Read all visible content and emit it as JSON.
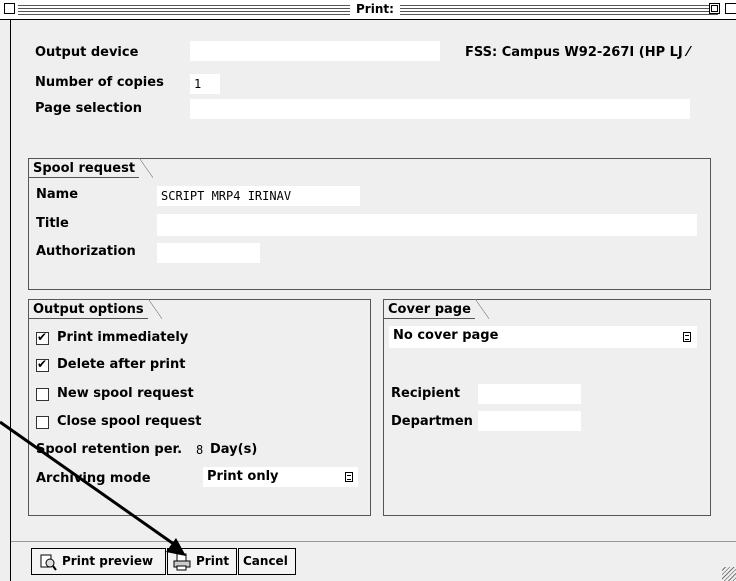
{
  "window": {
    "title": "Print:"
  },
  "header": {
    "output_device_label": "Output device",
    "output_device_value": "",
    "device_info": "FSS: Campus W92-267I (HP LJ ⁄",
    "copies_label": "Number of copies",
    "copies_value": "1",
    "page_selection_label": "Page selection",
    "page_selection_value": ""
  },
  "spool_request": {
    "heading": "Spool request",
    "name_label": "Name",
    "name_value": "SCRIPT MRP4 IRINAV",
    "title_label": "Title",
    "title_value": "",
    "authorization_label": "Authorization",
    "authorization_value": ""
  },
  "output_options": {
    "heading": "Output options",
    "print_immediately": {
      "label": "Print immediately",
      "checked": true
    },
    "delete_after_print": {
      "label": "Delete after print",
      "checked": true
    },
    "new_spool_request": {
      "label": "New spool request",
      "checked": false
    },
    "close_spool_request": {
      "label": "Close spool request",
      "checked": false
    },
    "retention_label": "Spool retention per.",
    "retention_value": "8",
    "retention_unit": "Day(s)",
    "archiving_label": "Archiving mode",
    "archiving_value": "Print only"
  },
  "cover_page": {
    "heading": "Cover page",
    "selection": "No cover page",
    "recipient_label": "Recipient",
    "recipient_value": "",
    "department_label": "Departmen",
    "department_value": ""
  },
  "buttons": {
    "preview": "Print preview",
    "print": "Print",
    "cancel": "Cancel"
  }
}
